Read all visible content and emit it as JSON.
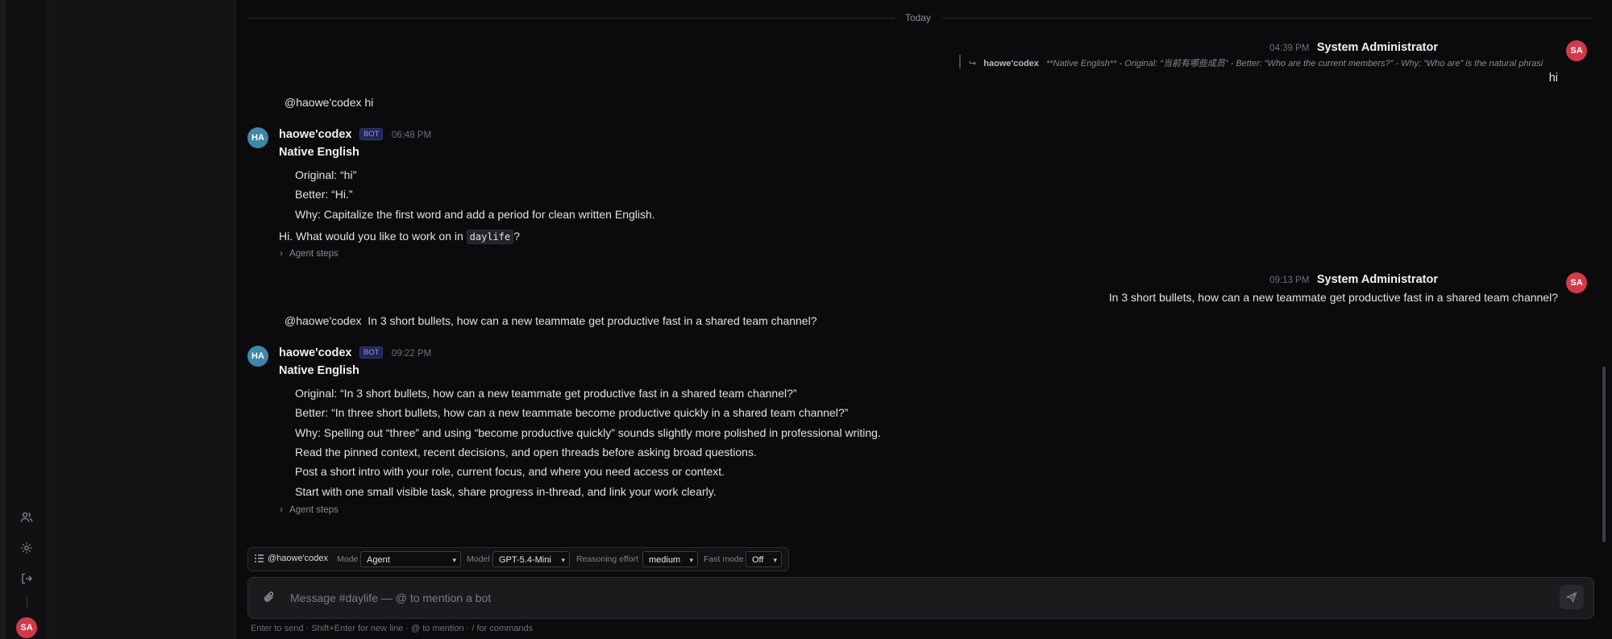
{
  "rail": {
    "icons": [
      "users-icon",
      "gear-icon",
      "logout-icon"
    ],
    "avatar": "SA"
  },
  "divider": {
    "label": "Today"
  },
  "messages": {
    "m1": {
      "time": "04:39 PM",
      "author": "System Administrator",
      "avatar": "SA",
      "reply_author": "haowe'codex",
      "reply_text": "**Native English** - Original: “当前有哪些成员” - Better: “Who are the current members?” - Why: “Who are” is the natural phrasi",
      "text": "hi"
    },
    "m2": {
      "text": "@haowe'codex hi"
    },
    "m3": {
      "author": "haowe'codex",
      "badge": "BOT",
      "time": "06:48 PM",
      "avatar": "HA",
      "heading": "Native English",
      "lines": [
        "Original: “hi”",
        "Better: “Hi.”",
        "Why: Capitalize the first word and add a period for clean written English."
      ],
      "reply_before": "Hi. What would you like to work on in",
      "reply_code": "daylife",
      "reply_after": "?",
      "agent_steps": "Agent steps"
    },
    "m4": {
      "time": "09:13 PM",
      "author": "System Administrator",
      "avatar": "SA",
      "text": "In 3 short bullets, how can a new teammate get productive fast in a shared team channel?"
    },
    "m5": {
      "text": "@haowe'codex  In 3 short bullets, how can a new teammate get productive fast in a shared team channel?"
    },
    "m6": {
      "author": "haowe'codex",
      "badge": "BOT",
      "time": "09:22 PM",
      "avatar": "HA",
      "heading": "Native English",
      "lines": [
        "Original: “In 3 short bullets, how can a new teammate get productive fast in a shared team channel?”",
        "Better: “In three short bullets, how can a new teammate become productive quickly in a shared team channel?”",
        "Why: Spelling out “three” and using “become productive quickly” sounds slightly more polished in professional writing.",
        "Read the pinned context, recent decisions, and open threads before asking broad questions.",
        "Post a short intro with your role, current focus, and where you need access or context.",
        "Start with one small visible task, share progress in-thread, and link your work clearly."
      ],
      "agent_steps": "Agent steps"
    }
  },
  "toolbar": {
    "bot": "@haowe'codex",
    "mode_label": "Mode",
    "mode_value": "Agent",
    "model_label": "Model",
    "model_value": "GPT-5.4-Mini",
    "effort_label": "Reasoning effort",
    "effort_value": "medium",
    "fast_label": "Fast mode",
    "fast_value": "Off"
  },
  "composer": {
    "placeholder": "Message #daylife — @ to mention a bot",
    "hint": "Enter to send · Shift+Enter for new line · @ to mention · / for commands"
  },
  "colors": {
    "background": "#0b0b0d",
    "avatar_admin": "#d13a4a",
    "avatar_bot": "#3f86a8",
    "bot_badge": "#8c96ff"
  }
}
